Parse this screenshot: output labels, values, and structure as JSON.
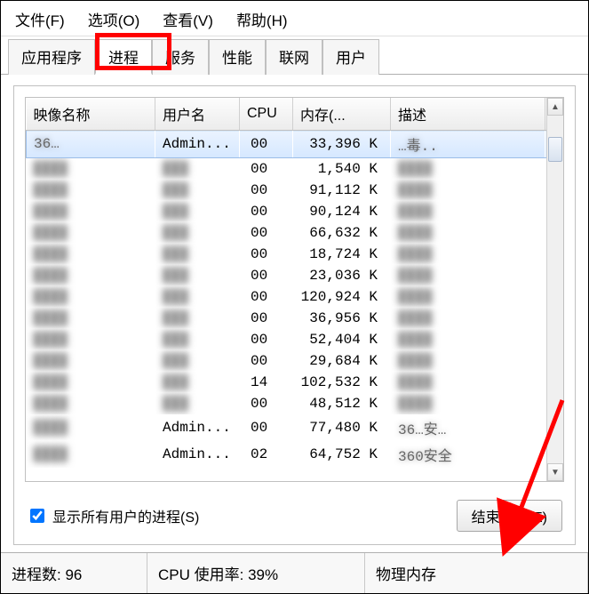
{
  "menu": {
    "file": "文件(F)",
    "options": "选项(O)",
    "view": "查看(V)",
    "help": "帮助(H)"
  },
  "tabs": {
    "apps": "应用程序",
    "processes": "进程",
    "services": "服务",
    "performance": "性能",
    "networking": "联网",
    "users": "用户"
  },
  "columns": {
    "image": "映像名称",
    "user": "用户名",
    "cpu": "CPU",
    "memory": "内存(...",
    "description": "描述"
  },
  "rows": [
    {
      "image": "36…",
      "user": "Admin...",
      "cpu": "00",
      "mem": "33,396 K",
      "desc": "…毒..",
      "selected": true
    },
    {
      "image": "",
      "user": "",
      "cpu": "00",
      "mem": "1,540 K",
      "desc": ""
    },
    {
      "image": "",
      "user": "",
      "cpu": "00",
      "mem": "91,112 K",
      "desc": ""
    },
    {
      "image": "",
      "user": "",
      "cpu": "00",
      "mem": "90,124 K",
      "desc": ""
    },
    {
      "image": "",
      "user": "",
      "cpu": "00",
      "mem": "66,632 K",
      "desc": ""
    },
    {
      "image": "",
      "user": "",
      "cpu": "00",
      "mem": "18,724 K",
      "desc": ""
    },
    {
      "image": "",
      "user": "",
      "cpu": "00",
      "mem": "23,036 K",
      "desc": ""
    },
    {
      "image": "",
      "user": "",
      "cpu": "00",
      "mem": "120,924 K",
      "desc": ""
    },
    {
      "image": "",
      "user": "",
      "cpu": "00",
      "mem": "36,956 K",
      "desc": ""
    },
    {
      "image": "",
      "user": "",
      "cpu": "00",
      "mem": "52,404 K",
      "desc": ""
    },
    {
      "image": "",
      "user": "",
      "cpu": "00",
      "mem": "29,684 K",
      "desc": ""
    },
    {
      "image": "",
      "user": "",
      "cpu": "14",
      "mem": "102,532 K",
      "desc": ""
    },
    {
      "image": "",
      "user": "",
      "cpu": "00",
      "mem": "48,512 K",
      "desc": ""
    },
    {
      "image": "",
      "user": "Admin...",
      "cpu": "00",
      "mem": "77,480 K",
      "desc": "36…安…"
    },
    {
      "image": "",
      "user": "Admin...",
      "cpu": "02",
      "mem": "64,752 K",
      "desc": "360安全"
    }
  ],
  "checkbox": {
    "label": "显示所有用户的进程(S)",
    "checked": true
  },
  "button": {
    "end_process": "结束进程(E)"
  },
  "status": {
    "processes_label": "进程数:",
    "processes_value": "96",
    "cpu_label": "CPU 使用率:",
    "cpu_value": "39%",
    "mem_label": "物理内存"
  }
}
